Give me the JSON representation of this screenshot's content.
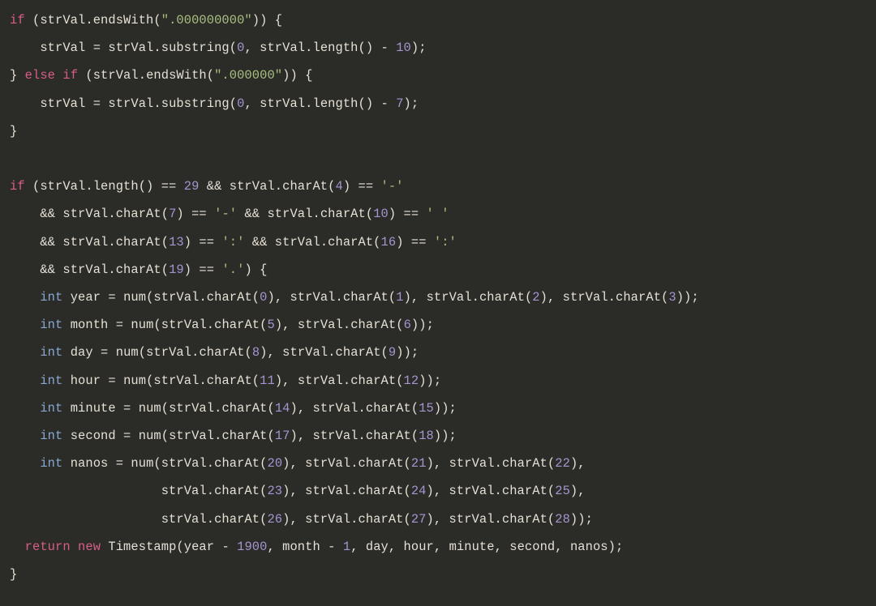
{
  "code": {
    "kw_if": "if",
    "kw_else": "else",
    "kw_return": "return",
    "kw_new": "new",
    "type_int": "int",
    "id_strVal": "strVal",
    "fn_endsWith": "endsWith",
    "fn_substring": "substring",
    "fn_length": "length",
    "fn_charAt": "charAt",
    "fn_num": "num",
    "id_Timestamp": "Timestamp",
    "id_year": "year",
    "id_month": "month",
    "id_day": "day",
    "id_hour": "hour",
    "id_minute": "minute",
    "id_second": "second",
    "id_nanos": "nanos",
    "str_9zeros": "\".000000000\"",
    "str_6zeros": "\".000000\"",
    "str_dash": "'-'",
    "str_space": "' '",
    "str_colon": "':'",
    "str_dot": "'.'",
    "n0": "0",
    "n1": "1",
    "n2": "2",
    "n3": "3",
    "n4": "4",
    "n5": "5",
    "n6": "6",
    "n7": "7",
    "n8": "8",
    "n9": "9",
    "n10": "10",
    "n11": "11",
    "n12": "12",
    "n13": "13",
    "n14": "14",
    "n15": "15",
    "n16": "16",
    "n17": "17",
    "n18": "18",
    "n19": "19",
    "n20": "20",
    "n21": "21",
    "n22": "22",
    "n23": "23",
    "n24": "24",
    "n25": "25",
    "n26": "26",
    "n27": "27",
    "n28": "28",
    "n29": "29",
    "n1900": "1900"
  }
}
